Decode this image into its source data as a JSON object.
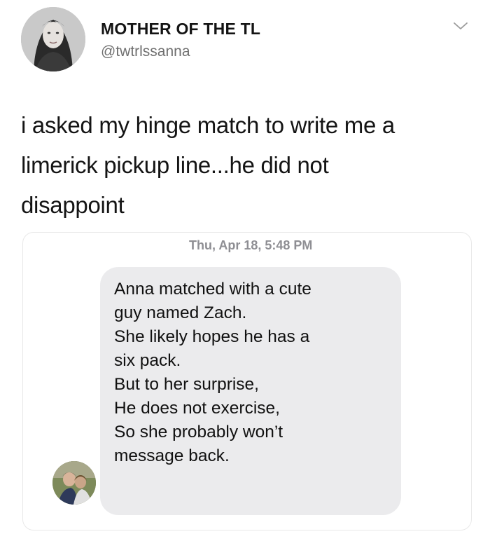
{
  "tweet": {
    "author": {
      "display_name": "MOTHER OF THE TL",
      "handle": "@twtrlssanna",
      "avatar_icon": "profile-photo-avatar"
    },
    "menu_icon": "chevron-down-icon",
    "text_lines": [
      "i asked my hinge match to write me a",
      "limerick pickup line...he did not",
      "disappoint"
    ]
  },
  "message_screenshot": {
    "timestamp": "Thu, Apr 18, 5:48 PM",
    "sender_avatar_icon": "sender-photo-avatar",
    "message_lines": [
      "Anna matched with a cute",
      "guy named Zach.",
      "She likely hopes he has a",
      "six pack.",
      "But to her surprise,",
      "He does not exercise,",
      "So she probably won’t",
      "message back."
    ],
    "bubble_color": "#ebebed",
    "timestamp_color": "#8e8e93"
  }
}
